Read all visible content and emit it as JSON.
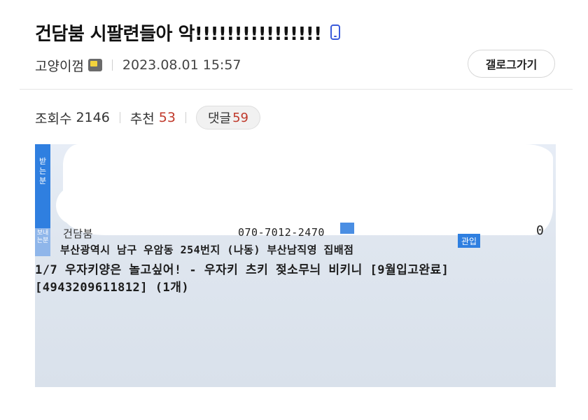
{
  "post": {
    "title": "건담붐 시팔련들아 악!!!!!!!!!!!!!!!!",
    "author": "고양이껌",
    "date": "2023.08.01 15:57",
    "gallery_button": "갤로그가기"
  },
  "stats": {
    "views_label": "조회수",
    "views": "2146",
    "recommend_label": "추천",
    "recommend": "53",
    "comments_label": "댓글",
    "comments": "59"
  },
  "photo": {
    "recipient": "건담붐",
    "phone": "070-7012-2470",
    "count": "0",
    "address": "부산광역시 남구 우암동 254번지 (나동) 부산남직영 집배점",
    "item": "1/7 우자키양은 놀고싶어! - 우자키 츠키 젖소무늬 비키니 [9월입고완료]",
    "code": "[4943209611812] (1개)",
    "stripe_top": "받는분",
    "stripe_bottom": "보내는분",
    "tag": "관입"
  },
  "colors": {
    "accent_blue": "#3b5bdb",
    "count_red": "#c0392b"
  }
}
